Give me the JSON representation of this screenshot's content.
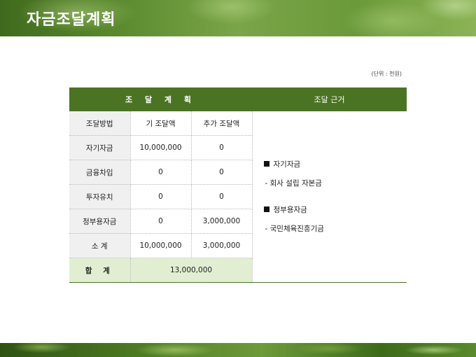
{
  "header": {
    "title": "자금조달계획"
  },
  "unit_note": "(단위 : 천원)",
  "table": {
    "head": {
      "plan": "조 달 계 획",
      "basis": "조달 근거"
    },
    "columns": {
      "method": "조달방법",
      "existing": "기 조달액",
      "additional": "추가 조달액"
    },
    "rows": [
      {
        "method": "자기자금",
        "existing": "10,000,000",
        "additional": "0"
      },
      {
        "method": "금융차입",
        "existing": "0",
        "additional": "0"
      },
      {
        "method": "투자유치",
        "existing": "0",
        "additional": "0"
      },
      {
        "method": "정부용자금",
        "existing": "0",
        "additional": "3,000,000"
      },
      {
        "method": "소 계",
        "existing": "10,000,000",
        "additional": "3,000,000"
      }
    ],
    "total": {
      "label": "합 계",
      "value": "13,000,000"
    },
    "basis": [
      {
        "heading": "자기자금",
        "detail": "- 회사 설립 자본금"
      },
      {
        "heading": "정부용자금",
        "detail": "- 국민체육진흥기금"
      }
    ]
  },
  "colors": {
    "header_green": "#4a7423",
    "total_bg": "#e2eed2",
    "label_bg": "#f0f0f0"
  }
}
